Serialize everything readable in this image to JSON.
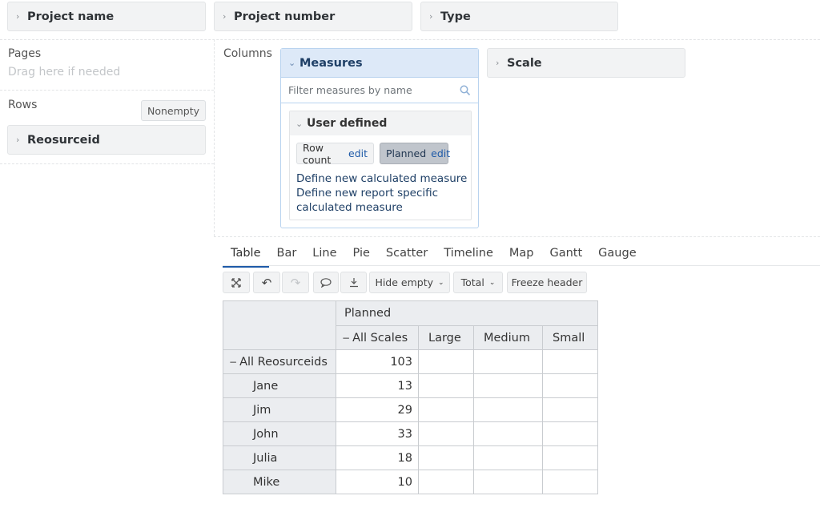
{
  "top_dims": [
    {
      "label": "Project name"
    },
    {
      "label": "Project number"
    },
    {
      "label": "Type"
    }
  ],
  "pages": {
    "label": "Pages",
    "hint": "Drag here if needed"
  },
  "rows": {
    "label": "Rows",
    "nonempty": "Nonempty",
    "dim": "Reosurceid"
  },
  "columns": {
    "label": "Columns",
    "scale_dim": "Scale"
  },
  "measures": {
    "title": "Measures",
    "filter_placeholder": "Filter measures by name",
    "group_title": "User defined",
    "items": [
      {
        "name": "Row count",
        "edit": "edit"
      },
      {
        "name": "Planned",
        "edit": "edit"
      }
    ],
    "link1": "Define new calculated measure",
    "link2_line1": "Define new report specific",
    "link2_line2": "calculated measure"
  },
  "tabs": [
    "Table",
    "Bar",
    "Line",
    "Pie",
    "Scatter",
    "Timeline",
    "Map",
    "Gantt",
    "Gauge"
  ],
  "toolbar": {
    "hide_empty": "Hide empty",
    "total": "Total",
    "freeze": "Freeze header"
  },
  "table": {
    "measure_header": "Planned",
    "col_headers": [
      "All Scales",
      "Large",
      "Medium",
      "Small"
    ],
    "rows": [
      {
        "label": "All Reosurceids",
        "values": [
          "103",
          "",
          "",
          ""
        ]
      },
      {
        "label": "Jane",
        "values": [
          "13",
          "",
          "",
          ""
        ]
      },
      {
        "label": "Jim",
        "values": [
          "29",
          "",
          "",
          ""
        ]
      },
      {
        "label": "John",
        "values": [
          "33",
          "",
          "",
          ""
        ]
      },
      {
        "label": "Julia",
        "values": [
          "18",
          "",
          "",
          ""
        ]
      },
      {
        "label": "Mike",
        "values": [
          "10",
          "",
          "",
          ""
        ]
      }
    ]
  }
}
